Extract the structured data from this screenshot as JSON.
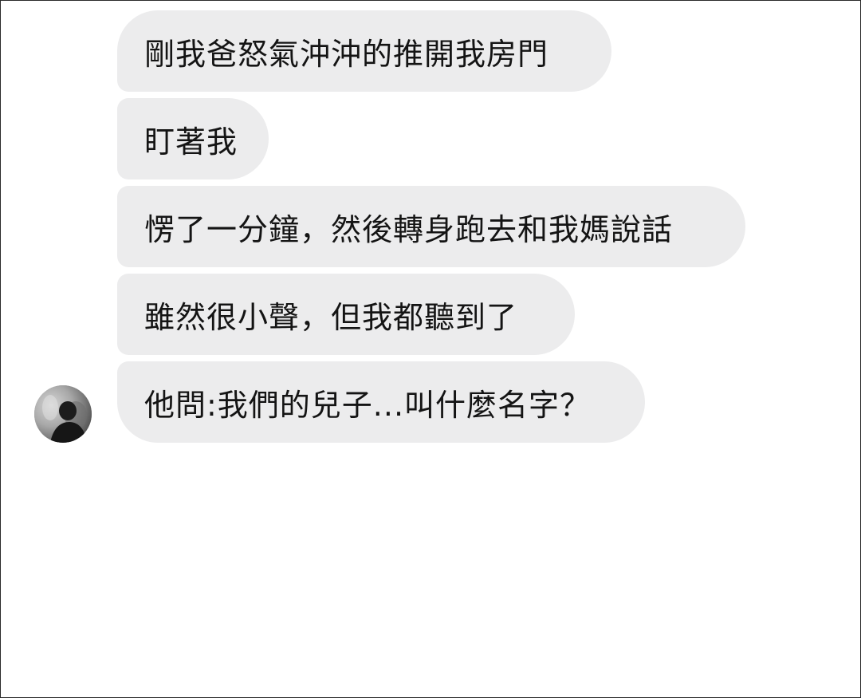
{
  "messages": [
    {
      "text": "剛我爸怒氣沖沖的推開我房門"
    },
    {
      "text": "盯著我"
    },
    {
      "text": "愣了一分鐘，然後轉身跑去和我媽說話"
    },
    {
      "text": "雖然很小聲，但我都聽到了"
    },
    {
      "text": "他問:我們的兒子...叫什麼名字？"
    }
  ],
  "sender": {
    "avatar_icon": "profile-photo"
  },
  "colors": {
    "bubble_background": "#ececed",
    "text": "#141414",
    "page_background": "#ffffff",
    "frame_border": "#2a2a2a"
  }
}
